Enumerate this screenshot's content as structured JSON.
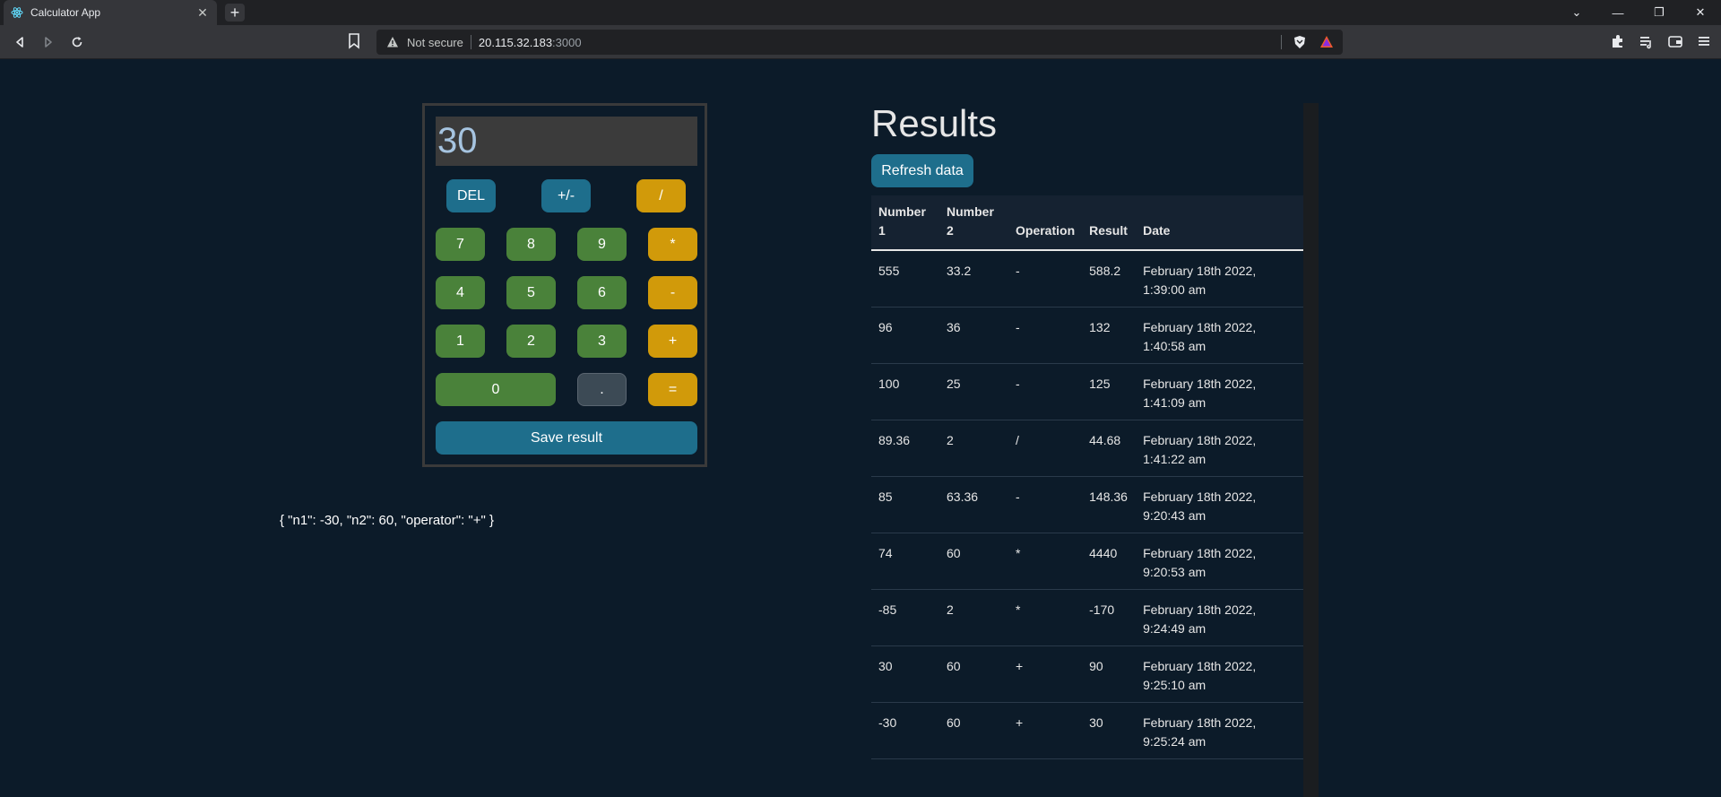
{
  "browser": {
    "tab_title": "Calculator App",
    "tab_close": "✕",
    "new_tab": "+",
    "security_label": "Not secure",
    "url_host": "20.115.32.183",
    "url_port": ":3000",
    "window_controls": [
      "⌄",
      "—",
      "❐",
      "✕"
    ]
  },
  "calculator": {
    "display_value": "30",
    "buttons": {
      "del": "DEL",
      "negate": "+/-",
      "divide": "/",
      "seven": "7",
      "eight": "8",
      "nine": "9",
      "multiply": "*",
      "four": "4",
      "five": "5",
      "six": "6",
      "subtract": "-",
      "one": "1",
      "two": "2",
      "three": "3",
      "add": "+",
      "zero": "0",
      "decimal": ".",
      "equals": "="
    },
    "save_label": "Save result",
    "json_output": "{ \"n1\": -30, \"n2\": 60, \"operator\": \"+\" }"
  },
  "results": {
    "title": "Results",
    "refresh_label": "Refresh data",
    "headers": [
      "Number 1",
      "Number 2",
      "Operation",
      "Result",
      "Date"
    ],
    "rows": [
      [
        "555",
        "33.2",
        "-",
        "588.2",
        "February 18th 2022, 1:39:00 am"
      ],
      [
        "96",
        "36",
        "-",
        "132",
        "February 18th 2022, 1:40:58 am"
      ],
      [
        "100",
        "25",
        "-",
        "125",
        "February 18th 2022, 1:41:09 am"
      ],
      [
        "89.36",
        "2",
        "/",
        "44.68",
        "February 18th 2022, 1:41:22 am"
      ],
      [
        "85",
        "63.36",
        "-",
        "148.36",
        "February 18th 2022, 9:20:43 am"
      ],
      [
        "74",
        "60",
        "*",
        "4440",
        "February 18th 2022, 9:20:53 am"
      ],
      [
        "-85",
        "2",
        "*",
        "-170",
        "February 18th 2022, 9:24:49 am"
      ],
      [
        "30",
        "60",
        "+",
        "90",
        "February 18th 2022, 9:25:10 am"
      ],
      [
        "-30",
        "60",
        "+",
        "30",
        "February 18th 2022, 9:25:24 am"
      ]
    ]
  },
  "colors": {
    "background": "#0c1b29",
    "button_blue": "#1e6e8c",
    "button_green": "#4a823a",
    "button_gold": "#d19a0a"
  }
}
